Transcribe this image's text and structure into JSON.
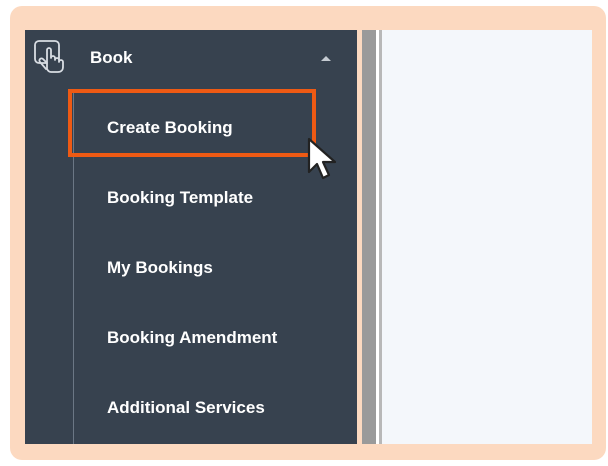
{
  "sidebar": {
    "section": {
      "label": "Book",
      "icon": "touch-hand-icon",
      "expanded": true
    },
    "items": [
      {
        "label": "Create Booking",
        "highlighted": true
      },
      {
        "label": "Booking Template"
      },
      {
        "label": "My Bookings"
      },
      {
        "label": "Booking Amendment"
      },
      {
        "label": "Additional Services"
      }
    ]
  },
  "colors": {
    "frame": "#fcd9c0",
    "sidebar_bg": "#37424f",
    "highlight": "#ee5a14",
    "content_bg": "#f4f7fb"
  }
}
